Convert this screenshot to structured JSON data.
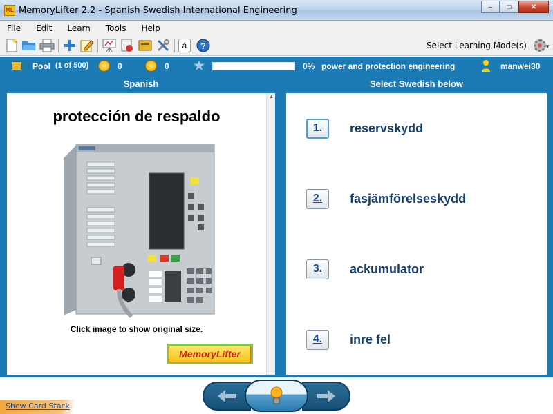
{
  "window": {
    "app_icon_text": "ML",
    "title": "MemoryLifter 2.2 - Spanish Swedish International Engineering",
    "minimize": "‒",
    "maximize": "□",
    "close": "✕"
  },
  "menu": [
    "File",
    "Edit",
    "Learn",
    "Tools",
    "Help"
  ],
  "toolbar": {
    "keyboard_label": "á",
    "help_label": "?",
    "learning_mode_label": "Select Learning Mode(s)"
  },
  "status": {
    "pool_label": "Pool",
    "pool_count": "(1 of 500)",
    "happy_count": "0",
    "sad_count": "0",
    "progress_fraction": 0,
    "progress_percent": "0%",
    "topic": "power and protection engineering",
    "user": "manwei30",
    "colors": {
      "bar": "#1c7bb5",
      "progress_fill": "#6ab04c"
    }
  },
  "question": {
    "header": "Spanish",
    "word": "protección de respaldo",
    "caption": "Click image to show original size.",
    "logo_text": "MemoryLifter",
    "image": "protection-relay-device"
  },
  "answers": {
    "header": "Select Swedish below",
    "items": [
      {
        "number": "1.",
        "text": "reservskydd"
      },
      {
        "number": "2.",
        "text": "fasjämförelseskydd"
      },
      {
        "number": "3.",
        "text": "ackumulator"
      },
      {
        "number": "4.",
        "text": "inre fel"
      }
    ]
  },
  "nav": {
    "back_icon": "arrow-left-icon",
    "hint_icon": "lightbulb-icon",
    "forward_icon": "arrow-right-icon"
  },
  "footer": {
    "show_card_stack": "Show Card Stack"
  }
}
